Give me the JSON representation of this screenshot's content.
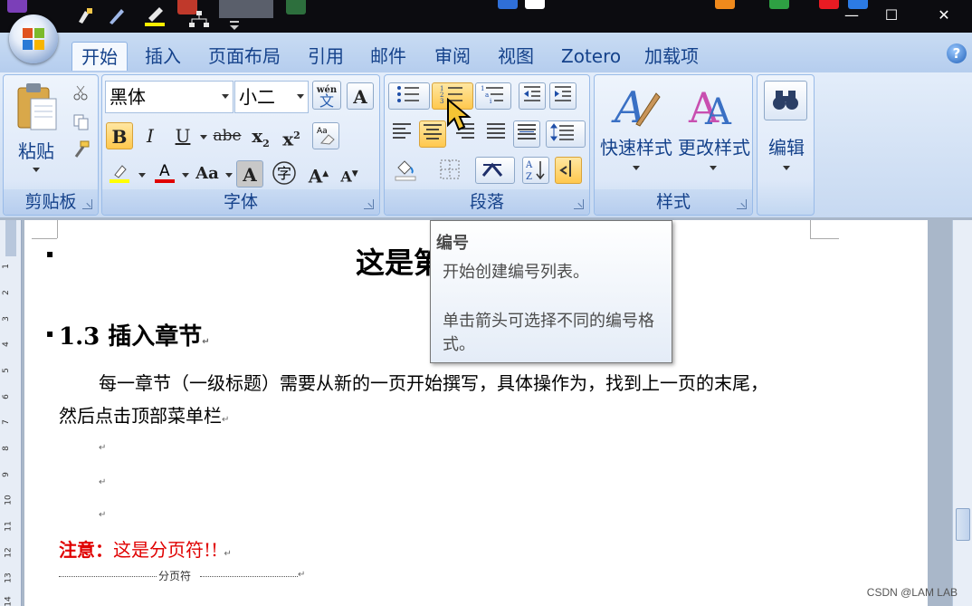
{
  "window": {
    "minimize": "—",
    "maximize": "☐",
    "close": "✕"
  },
  "tabs": [
    {
      "label": "开始",
      "active": true
    },
    {
      "label": "插入"
    },
    {
      "label": "页面布局"
    },
    {
      "label": "引用"
    },
    {
      "label": "邮件"
    },
    {
      "label": "审阅"
    },
    {
      "label": "视图"
    },
    {
      "label": "Zotero"
    },
    {
      "label": "加载项"
    }
  ],
  "clipboard": {
    "paste_label": "粘贴",
    "group_label": "剪贴板"
  },
  "font": {
    "family": "黑体",
    "size": "小二",
    "group_label": "字体",
    "phonetic_icon": "wén",
    "highlight_color": "#ffff00",
    "font_color": "#e00000"
  },
  "paragraph": {
    "group_label": "段落"
  },
  "styles": {
    "quick_label": "快速样式",
    "change_label": "更改样式",
    "group_label": "样式"
  },
  "editing": {
    "label": "编辑"
  },
  "tooltip": {
    "title": "编号",
    "line1": "开始创建编号列表。",
    "line2": "单击箭头可选择不同的编号格式。"
  },
  "document": {
    "title_visible": "这是第",
    "heading": "1.3 插入章节",
    "body_line1": "每一章节（一级标题）需要从新的一页开始撰写，具体操作为，找到上一页的末尾，",
    "body_line2": "然后点击顶部菜单栏",
    "note_label": "注意：",
    "note_text": "这是分页符!!",
    "page_break": "分页符"
  },
  "watermark": "CSDN @LAM LAB"
}
